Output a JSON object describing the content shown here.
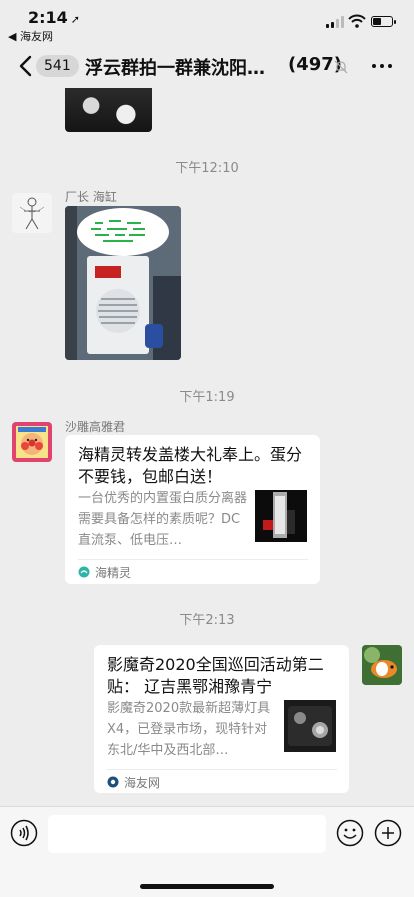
{
  "status_bar": {
    "time": "2:14",
    "back_to_app": "◀ 海友网"
  },
  "navbar": {
    "unread_badge": "541",
    "title": "浮云群拍一群兼沈阳团…",
    "member_count": "(497)"
  },
  "messages": [
    {
      "type": "timestamp",
      "text": "下午12:10"
    },
    {
      "type": "image",
      "sender": "厂长 海缸",
      "bubble_text": ""
    },
    {
      "type": "timestamp",
      "text": "下午1:19"
    },
    {
      "type": "link_card",
      "sender": "沙雕高雅君",
      "title": "海精灵转发盖楼大礼奉上。蛋分不要钱，包邮白送！",
      "desc": "一台优秀的内置蛋白质分离器需要具备怎样的素质呢？DC直流泵、低电压…",
      "source": "海精灵"
    },
    {
      "type": "timestamp",
      "text": "下午2:13"
    },
    {
      "type": "link_card",
      "self": true,
      "title": "影魔奇2020全国巡回活动第二贴：  辽吉黑鄂湘豫青宁",
      "desc": "影魔奇2020款最新超薄灯具X4，已登录市场，现特针对东北/华中及西北部…",
      "source": "海友网"
    }
  ],
  "colors": {
    "background": "#ededed",
    "bubble": "#ffffff",
    "input_bar": "#f6f6f6"
  }
}
